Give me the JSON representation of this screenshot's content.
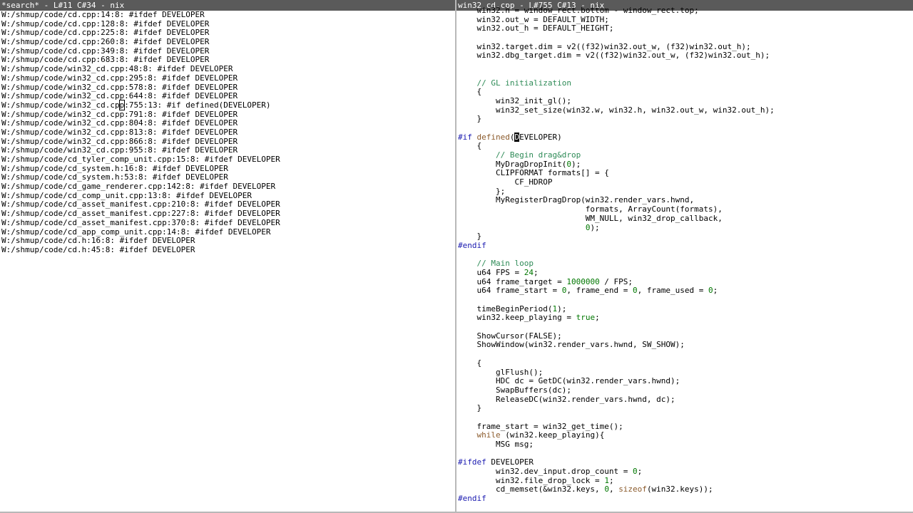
{
  "left": {
    "title": "*search* - L#11 C#34 - nix",
    "cursor_line": 10,
    "cursor_col": 25,
    "lines": [
      "W:/shmup/code/cd.cpp:14:8: #ifdef DEVELOPER",
      "W:/shmup/code/cd.cpp:128:8: #ifdef DEVELOPER",
      "W:/shmup/code/cd.cpp:225:8: #ifdef DEVELOPER",
      "W:/shmup/code/cd.cpp:260:8: #ifdef DEVELOPER",
      "W:/shmup/code/cd.cpp:349:8: #ifdef DEVELOPER",
      "W:/shmup/code/cd.cpp:683:8: #ifdef DEVELOPER",
      "W:/shmup/code/win32_cd.cpp:48:8: #ifdef DEVELOPER",
      "W:/shmup/code/win32_cd.cpp:295:8: #ifdef DEVELOPER",
      "W:/shmup/code/win32_cd.cpp:578:8: #ifdef DEVELOPER",
      "W:/shmup/code/win32_cd.cpp:644:8: #ifdef DEVELOPER",
      "W:/shmup/code/win32_cd.cpp:755:13: #if defined(DEVELOPER)",
      "W:/shmup/code/win32_cd.cpp:791:8: #ifdef DEVELOPER",
      "W:/shmup/code/win32_cd.cpp:804:8: #ifdef DEVELOPER",
      "W:/shmup/code/win32_cd.cpp:813:8: #ifdef DEVELOPER",
      "W:/shmup/code/win32_cd.cpp:866:8: #ifdef DEVELOPER",
      "W:/shmup/code/win32_cd.cpp:955:8: #ifdef DEVELOPER",
      "W:/shmup/code/cd_tyler_comp_unit.cpp:15:8: #ifdef DEVELOPER",
      "W:/shmup/code/cd_system.h:16:8: #ifdef DEVELOPER",
      "W:/shmup/code/cd_system.h:53:8: #ifdef DEVELOPER",
      "W:/shmup/code/cd_game_renderer.cpp:142:8: #ifdef DEVELOPER",
      "W:/shmup/code/cd_comp_unit.cpp:13:8: #ifdef DEVELOPER",
      "W:/shmup/code/cd_asset_manifest.cpp:210:8: #ifdef DEVELOPER",
      "W:/shmup/code/cd_asset_manifest.cpp:227:8: #ifdef DEVELOPER",
      "W:/shmup/code/cd_asset_manifest.cpp:370:8: #ifdef DEVELOPER",
      "W:/shmup/code/cd_app_comp_unit.cpp:14:8: #ifdef DEVELOPER",
      "W:/shmup/code/cd.h:16:8: #ifdef DEVELOPER",
      "W:/shmup/code/cd.h:45:8: #ifdef DEVELOPER"
    ]
  },
  "right": {
    "title": "win32_cd.cpp - L#755 C#13 - nix",
    "cursor_line": 14,
    "cursor_col": 12,
    "colors": {
      "kw": "#8b5a2b",
      "num": "#007700",
      "cm": "#2e8b57",
      "pp": "#1a1ab0",
      "tx": "#000000"
    },
    "lines": [
      [
        [
          "tx",
          "    win32.h = window_rect.bottom - window_rect.top;"
        ]
      ],
      [
        [
          "tx",
          "    win32.out_w = DEFAULT_WIDTH;"
        ]
      ],
      [
        [
          "tx",
          "    win32.out_h = DEFAULT_HEIGHT;"
        ]
      ],
      [],
      [
        [
          "tx",
          "    win32.target.dim = v2((f32)win32.out_w, (f32)win32.out_h);"
        ]
      ],
      [
        [
          "tx",
          "    win32.dbg_target.dim = v2((f32)win32.out_w, (f32)win32.out_h);"
        ]
      ],
      [],
      [],
      [
        [
          "cm",
          "    // GL initialization"
        ]
      ],
      [
        [
          "tx",
          "    {"
        ]
      ],
      [
        [
          "tx",
          "        win32_init_gl();"
        ]
      ],
      [
        [
          "tx",
          "        win32_set_size(win32.w, win32.h, win32.out_w, win32.out_h);"
        ]
      ],
      [
        [
          "tx",
          "    }"
        ]
      ],
      [],
      [
        [
          "pp",
          "#if "
        ],
        [
          "kw",
          "defined"
        ],
        [
          "tx",
          "(DEVELOPER)"
        ]
      ],
      [
        [
          "tx",
          "    {"
        ]
      ],
      [
        [
          "cm",
          "        // Begin drag&drop"
        ]
      ],
      [
        [
          "tx",
          "        MyDragDropInit("
        ],
        [
          "num",
          "0"
        ],
        [
          "tx",
          ");"
        ]
      ],
      [
        [
          "tx",
          "        CLIPFORMAT formats[] = {"
        ]
      ],
      [
        [
          "tx",
          "            CF_HDROP"
        ]
      ],
      [
        [
          "tx",
          "        };"
        ]
      ],
      [
        [
          "tx",
          "        MyRegisterDragDrop(win32.render_vars.hwnd,"
        ]
      ],
      [
        [
          "tx",
          "                           formats, ArrayCount(formats),"
        ]
      ],
      [
        [
          "tx",
          "                           WM_NULL, win32_drop_callback,"
        ]
      ],
      [
        [
          "tx",
          "                           "
        ],
        [
          "num",
          "0"
        ],
        [
          "tx",
          ");"
        ]
      ],
      [
        [
          "tx",
          "    }"
        ]
      ],
      [
        [
          "pp",
          "#endif"
        ]
      ],
      [],
      [
        [
          "cm",
          "    // Main loop"
        ]
      ],
      [
        [
          "tx",
          "    u64 FPS = "
        ],
        [
          "num",
          "24"
        ],
        [
          "tx",
          ";"
        ]
      ],
      [
        [
          "tx",
          "    u64 frame_target = "
        ],
        [
          "num",
          "1000000"
        ],
        [
          "tx",
          " / FPS;"
        ]
      ],
      [
        [
          "tx",
          "    u64 frame_start = "
        ],
        [
          "num",
          "0"
        ],
        [
          "tx",
          ", frame_end = "
        ],
        [
          "num",
          "0"
        ],
        [
          "tx",
          ", frame_used = "
        ],
        [
          "num",
          "0"
        ],
        [
          "tx",
          ";"
        ]
      ],
      [],
      [
        [
          "tx",
          "    timeBeginPeriod("
        ],
        [
          "num",
          "1"
        ],
        [
          "tx",
          ");"
        ]
      ],
      [
        [
          "tx",
          "    win32.keep_playing = "
        ],
        [
          "num",
          "true"
        ],
        [
          "tx",
          ";"
        ]
      ],
      [],
      [
        [
          "tx",
          "    ShowCursor(FALSE);"
        ]
      ],
      [
        [
          "tx",
          "    ShowWindow(win32.render_vars.hwnd, SW_SHOW);"
        ]
      ],
      [],
      [
        [
          "tx",
          "    {"
        ]
      ],
      [
        [
          "tx",
          "        glFlush();"
        ]
      ],
      [
        [
          "tx",
          "        HDC dc = GetDC(win32.render_vars.hwnd);"
        ]
      ],
      [
        [
          "tx",
          "        SwapBuffers(dc);"
        ]
      ],
      [
        [
          "tx",
          "        ReleaseDC(win32.render_vars.hwnd, dc);"
        ]
      ],
      [
        [
          "tx",
          "    }"
        ]
      ],
      [],
      [
        [
          "tx",
          "    frame_start = win32_get_time();"
        ]
      ],
      [
        [
          "tx",
          "    "
        ],
        [
          "kw",
          "while"
        ],
        [
          "tx",
          " (win32.keep_playing){"
        ]
      ],
      [
        [
          "tx",
          "        MSG msg;"
        ]
      ],
      [],
      [
        [
          "pp",
          "#ifdef "
        ],
        [
          "tx",
          "DEVELOPER"
        ]
      ],
      [
        [
          "tx",
          "        win32.dev_input.drop_count = "
        ],
        [
          "num",
          "0"
        ],
        [
          "tx",
          ";"
        ]
      ],
      [
        [
          "tx",
          "        win32.file_drop_lock = "
        ],
        [
          "num",
          "1"
        ],
        [
          "tx",
          ";"
        ]
      ],
      [
        [
          "tx",
          "        cd_memset(&win32.keys, "
        ],
        [
          "num",
          "0"
        ],
        [
          "tx",
          ", "
        ],
        [
          "kw",
          "sizeof"
        ],
        [
          "tx",
          "(win32.keys));"
        ]
      ],
      [
        [
          "pp",
          "#endif"
        ]
      ]
    ]
  }
}
